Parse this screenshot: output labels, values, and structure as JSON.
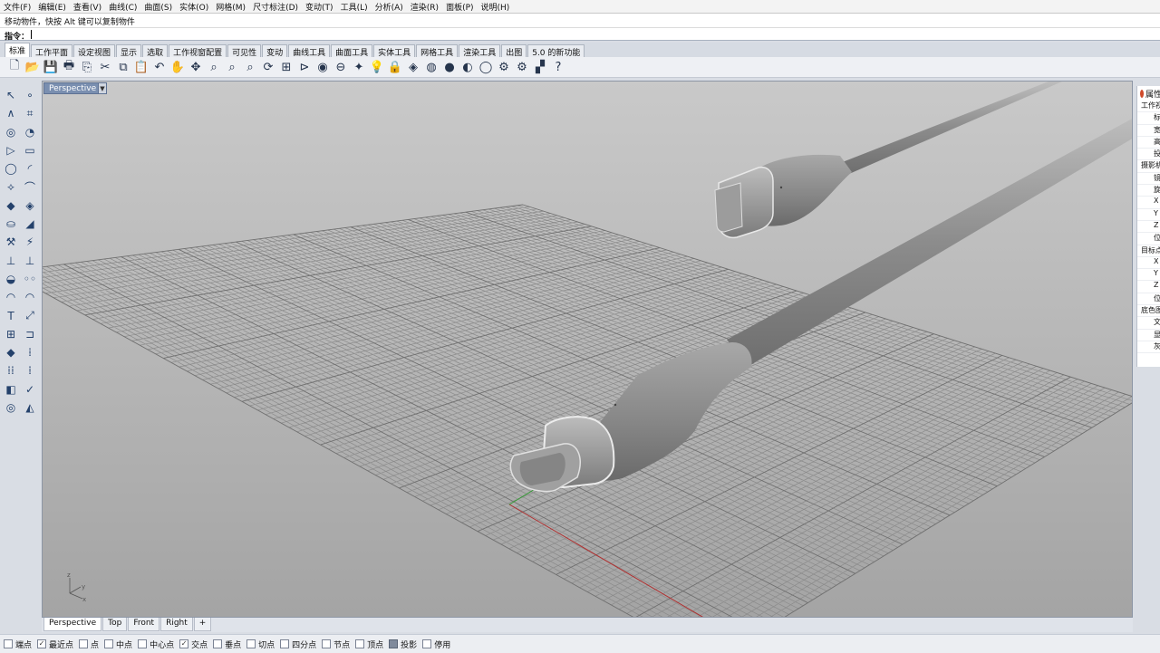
{
  "menus": [
    "文件(F)",
    "编辑(E)",
    "查看(V)",
    "曲线(C)",
    "曲面(S)",
    "实体(O)",
    "网格(M)",
    "尺寸标注(D)",
    "变动(T)",
    "工具(L)",
    "分析(A)",
    "渲染(R)",
    "面板(P)",
    "说明(H)"
  ],
  "command": {
    "history": "移动物件，快按 Alt 键可以复制物件",
    "prompt": "指令："
  },
  "tabs": [
    "标准",
    "工作平面",
    "设定视图",
    "显示",
    "选取",
    "工作视窗配置",
    "可见性",
    "变动",
    "曲线工具",
    "曲面工具",
    "实体工具",
    "网格工具",
    "渲染工具",
    "出图",
    "5.0 的新功能"
  ],
  "active_tab": "标准",
  "toolbar_icons": [
    "new-icon",
    "open-icon",
    "save-icon",
    "print-icon",
    "import-icon",
    "cut-icon",
    "copy-icon",
    "paste-icon",
    "undo-icon",
    "pan-hand-icon",
    "move-view-icon",
    "zoom-icon",
    "zoom-window-icon",
    "zoom-selected-icon",
    "rotate-view-icon",
    "four-viewports-icon",
    "car-icon",
    "camera-icon",
    "cplane-icon",
    "display-icon",
    "light-bulb-icon",
    "lock-icon",
    "layer-icon",
    "color-wheel-icon",
    "sphere-icon",
    "shaded-sphere-icon",
    "render-sphere-icon",
    "options-icon",
    "gear-icon",
    "select-filter-icon",
    "help-icon"
  ],
  "viewport": {
    "name": "Perspective",
    "tabs": [
      "Perspective",
      "Top",
      "Front",
      "Right"
    ],
    "add_tab": "+",
    "axis_labels": [
      "z",
      "y",
      "x"
    ],
    "colors": {
      "background_top": "#c9c9c9",
      "background_bottom": "#a4a4a4",
      "grid": "#8a8a8a",
      "x_axis": "#b03030",
      "y_axis": "#2f9a2f"
    }
  },
  "properties_panel": {
    "title": "属性",
    "rows": [
      {
        "label": "工作视窗",
        "type": "section"
      },
      {
        "label": "标题",
        "type": "sub"
      },
      {
        "label": "宽度",
        "type": "sub"
      },
      {
        "label": "高度",
        "type": "sub"
      },
      {
        "label": "投影",
        "type": "sub"
      },
      {
        "label": "摄影机",
        "type": "section"
      },
      {
        "label": "镜头",
        "type": "sub"
      },
      {
        "label": "旋转",
        "type": "sub"
      },
      {
        "label": "X",
        "type": "sub"
      },
      {
        "label": "Y",
        "type": "sub"
      },
      {
        "label": "Z",
        "type": "sub"
      },
      {
        "label": "位置",
        "type": "sub"
      },
      {
        "label": "目标点",
        "type": "section"
      },
      {
        "label": "X",
        "type": "sub"
      },
      {
        "label": "Y",
        "type": "sub"
      },
      {
        "label": "Z",
        "type": "sub"
      },
      {
        "label": "位置",
        "type": "sub"
      },
      {
        "label": "底色图",
        "type": "section"
      },
      {
        "label": "文件",
        "type": "sub"
      },
      {
        "label": "显示",
        "type": "sub"
      },
      {
        "label": "灰阶",
        "type": "sub"
      }
    ]
  },
  "osnaps": [
    {
      "label": "端点",
      "checked": false
    },
    {
      "label": "最近点",
      "checked": true
    },
    {
      "label": "点",
      "checked": false
    },
    {
      "label": "中点",
      "checked": false
    },
    {
      "label": "中心点",
      "checked": false
    },
    {
      "label": "交点",
      "checked": true
    },
    {
      "label": "垂点",
      "checked": false
    },
    {
      "label": "切点",
      "checked": false
    },
    {
      "label": "四分点",
      "checked": false
    },
    {
      "label": "节点",
      "checked": false
    },
    {
      "label": "顶点",
      "checked": false
    },
    {
      "label": "投影",
      "checked": true,
      "style": "filled"
    },
    {
      "label": "停用",
      "checked": false
    }
  ]
}
